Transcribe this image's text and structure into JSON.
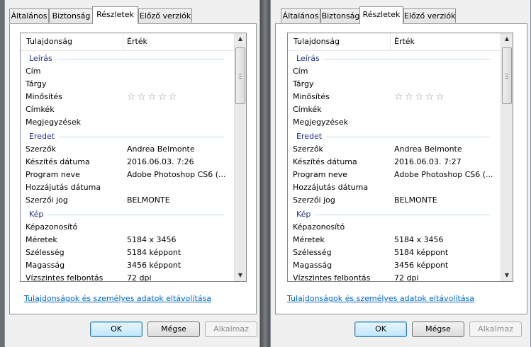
{
  "dialogs": [
    {
      "tabs": [
        "Általános",
        "Biztonság",
        "Részletek",
        "Előző verziók"
      ],
      "active_tab": 2,
      "columns": [
        "Tulajdonság",
        "Érték"
      ],
      "groups": [
        {
          "label": "Leírás",
          "rows": [
            {
              "k": "Cím",
              "v": ""
            },
            {
              "k": "Tárgy",
              "v": ""
            },
            {
              "k": "Minősítés",
              "stars": 0
            },
            {
              "k": "Címkék",
              "v": ""
            },
            {
              "k": "Megjegyzések",
              "v": ""
            }
          ]
        },
        {
          "label": "Eredet",
          "rows": [
            {
              "k": "Szerzők",
              "v": "Andrea Belmonte"
            },
            {
              "k": "Készítés dátuma",
              "v": "2016.06.03. 7:26"
            },
            {
              "k": "Program neve",
              "v": "Adobe Photoshop CS6 (..."
            },
            {
              "k": "Hozzájutás dátuma",
              "v": ""
            },
            {
              "k": "Szerzői jog",
              "v": "BELMONTE"
            }
          ]
        },
        {
          "label": "Kép",
          "rows": [
            {
              "k": "Képazonosító",
              "v": ""
            },
            {
              "k": "Méretek",
              "v": "5184 x 3456"
            },
            {
              "k": "Szélesség",
              "v": "5184 képpont"
            },
            {
              "k": "Magasság",
              "v": "3456 képpont"
            },
            {
              "k": "Vízszintes felbontás",
              "v": "72 dpi"
            }
          ]
        }
      ],
      "link": "Tulajdonságok és személyes adatok eltávolítása",
      "buttons": {
        "ok": "OK",
        "cancel": "Mégse",
        "apply": "Alkalmaz"
      }
    },
    {
      "tabs": [
        "Általános",
        "Biztonság",
        "Részletek",
        "Előző verziók"
      ],
      "active_tab": 2,
      "columns": [
        "Tulajdonság",
        "Érték"
      ],
      "groups": [
        {
          "label": "Leírás",
          "rows": [
            {
              "k": "Cím",
              "v": ""
            },
            {
              "k": "Tárgy",
              "v": ""
            },
            {
              "k": "Minősítés",
              "stars": 0
            },
            {
              "k": "Címkék",
              "v": ""
            },
            {
              "k": "Megjegyzések",
              "v": ""
            }
          ]
        },
        {
          "label": "Eredet",
          "rows": [
            {
              "k": "Szerzők",
              "v": "Andrea Belmonte"
            },
            {
              "k": "Készítés dátuma",
              "v": "2016.06.03. 7:27"
            },
            {
              "k": "Program neve",
              "v": "Adobe Photoshop CS6 (..."
            },
            {
              "k": "Hozzájutás dátuma",
              "v": ""
            },
            {
              "k": "Szerzői jog",
              "v": "BELMONTE"
            }
          ]
        },
        {
          "label": "Kép",
          "rows": [
            {
              "k": "Képazonosító",
              "v": ""
            },
            {
              "k": "Méretek",
              "v": "5184 x 3456"
            },
            {
              "k": "Szélesség",
              "v": "5184 képpont"
            },
            {
              "k": "Magasság",
              "v": "3456 képpont"
            },
            {
              "k": "Vízszintes felbontás",
              "v": "72 dpi"
            }
          ]
        }
      ],
      "link": "Tulajdonságok és személyes adatok eltávolítása",
      "buttons": {
        "ok": "OK",
        "cancel": "Mégse",
        "apply": "Alkalmaz"
      }
    }
  ],
  "icons": {
    "star": "empty-star-icon",
    "scroll_up": "arrow-up-icon",
    "scroll_down": "arrow-down-icon"
  },
  "colors": {
    "group_label": "#1e3287",
    "link": "#0066cc",
    "group_line": "#c5dbe9"
  }
}
